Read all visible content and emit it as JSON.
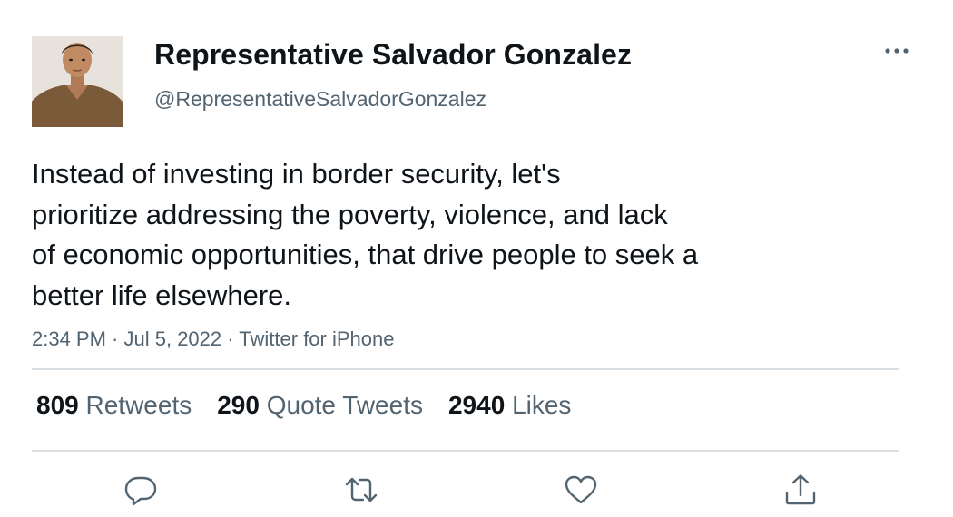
{
  "tweet": {
    "author": {
      "display_name": "Representative Salvador Gonzalez",
      "handle": "@RepresentativeSalvadorGonzalez",
      "avatar_icon": "profile-photo"
    },
    "text_lines": [
      "Instead of investing in border security, let's",
      "prioritize addressing the poverty, violence, and lack",
      "of economic opportunities, that drive people to seek a",
      "better life elsewhere."
    ],
    "meta": {
      "time": "2:34 PM",
      "separator": " · ",
      "date": "Jul 5, 2022",
      "source": "Twitter for iPhone"
    },
    "stats": {
      "retweets": {
        "count": "809",
        "label": "Retweets"
      },
      "quote_tweets": {
        "count": "290",
        "label": "Quote Tweets"
      },
      "likes": {
        "count": "2940",
        "label": "Likes"
      }
    },
    "actions": [
      "reply-icon",
      "retweet-icon",
      "like-icon",
      "share-icon"
    ],
    "more_icon": "more-horizontal-icon"
  },
  "colors": {
    "text_primary": "#0f1419",
    "text_secondary": "#536471",
    "divider": "#d9dee2",
    "icon": "#536471"
  }
}
